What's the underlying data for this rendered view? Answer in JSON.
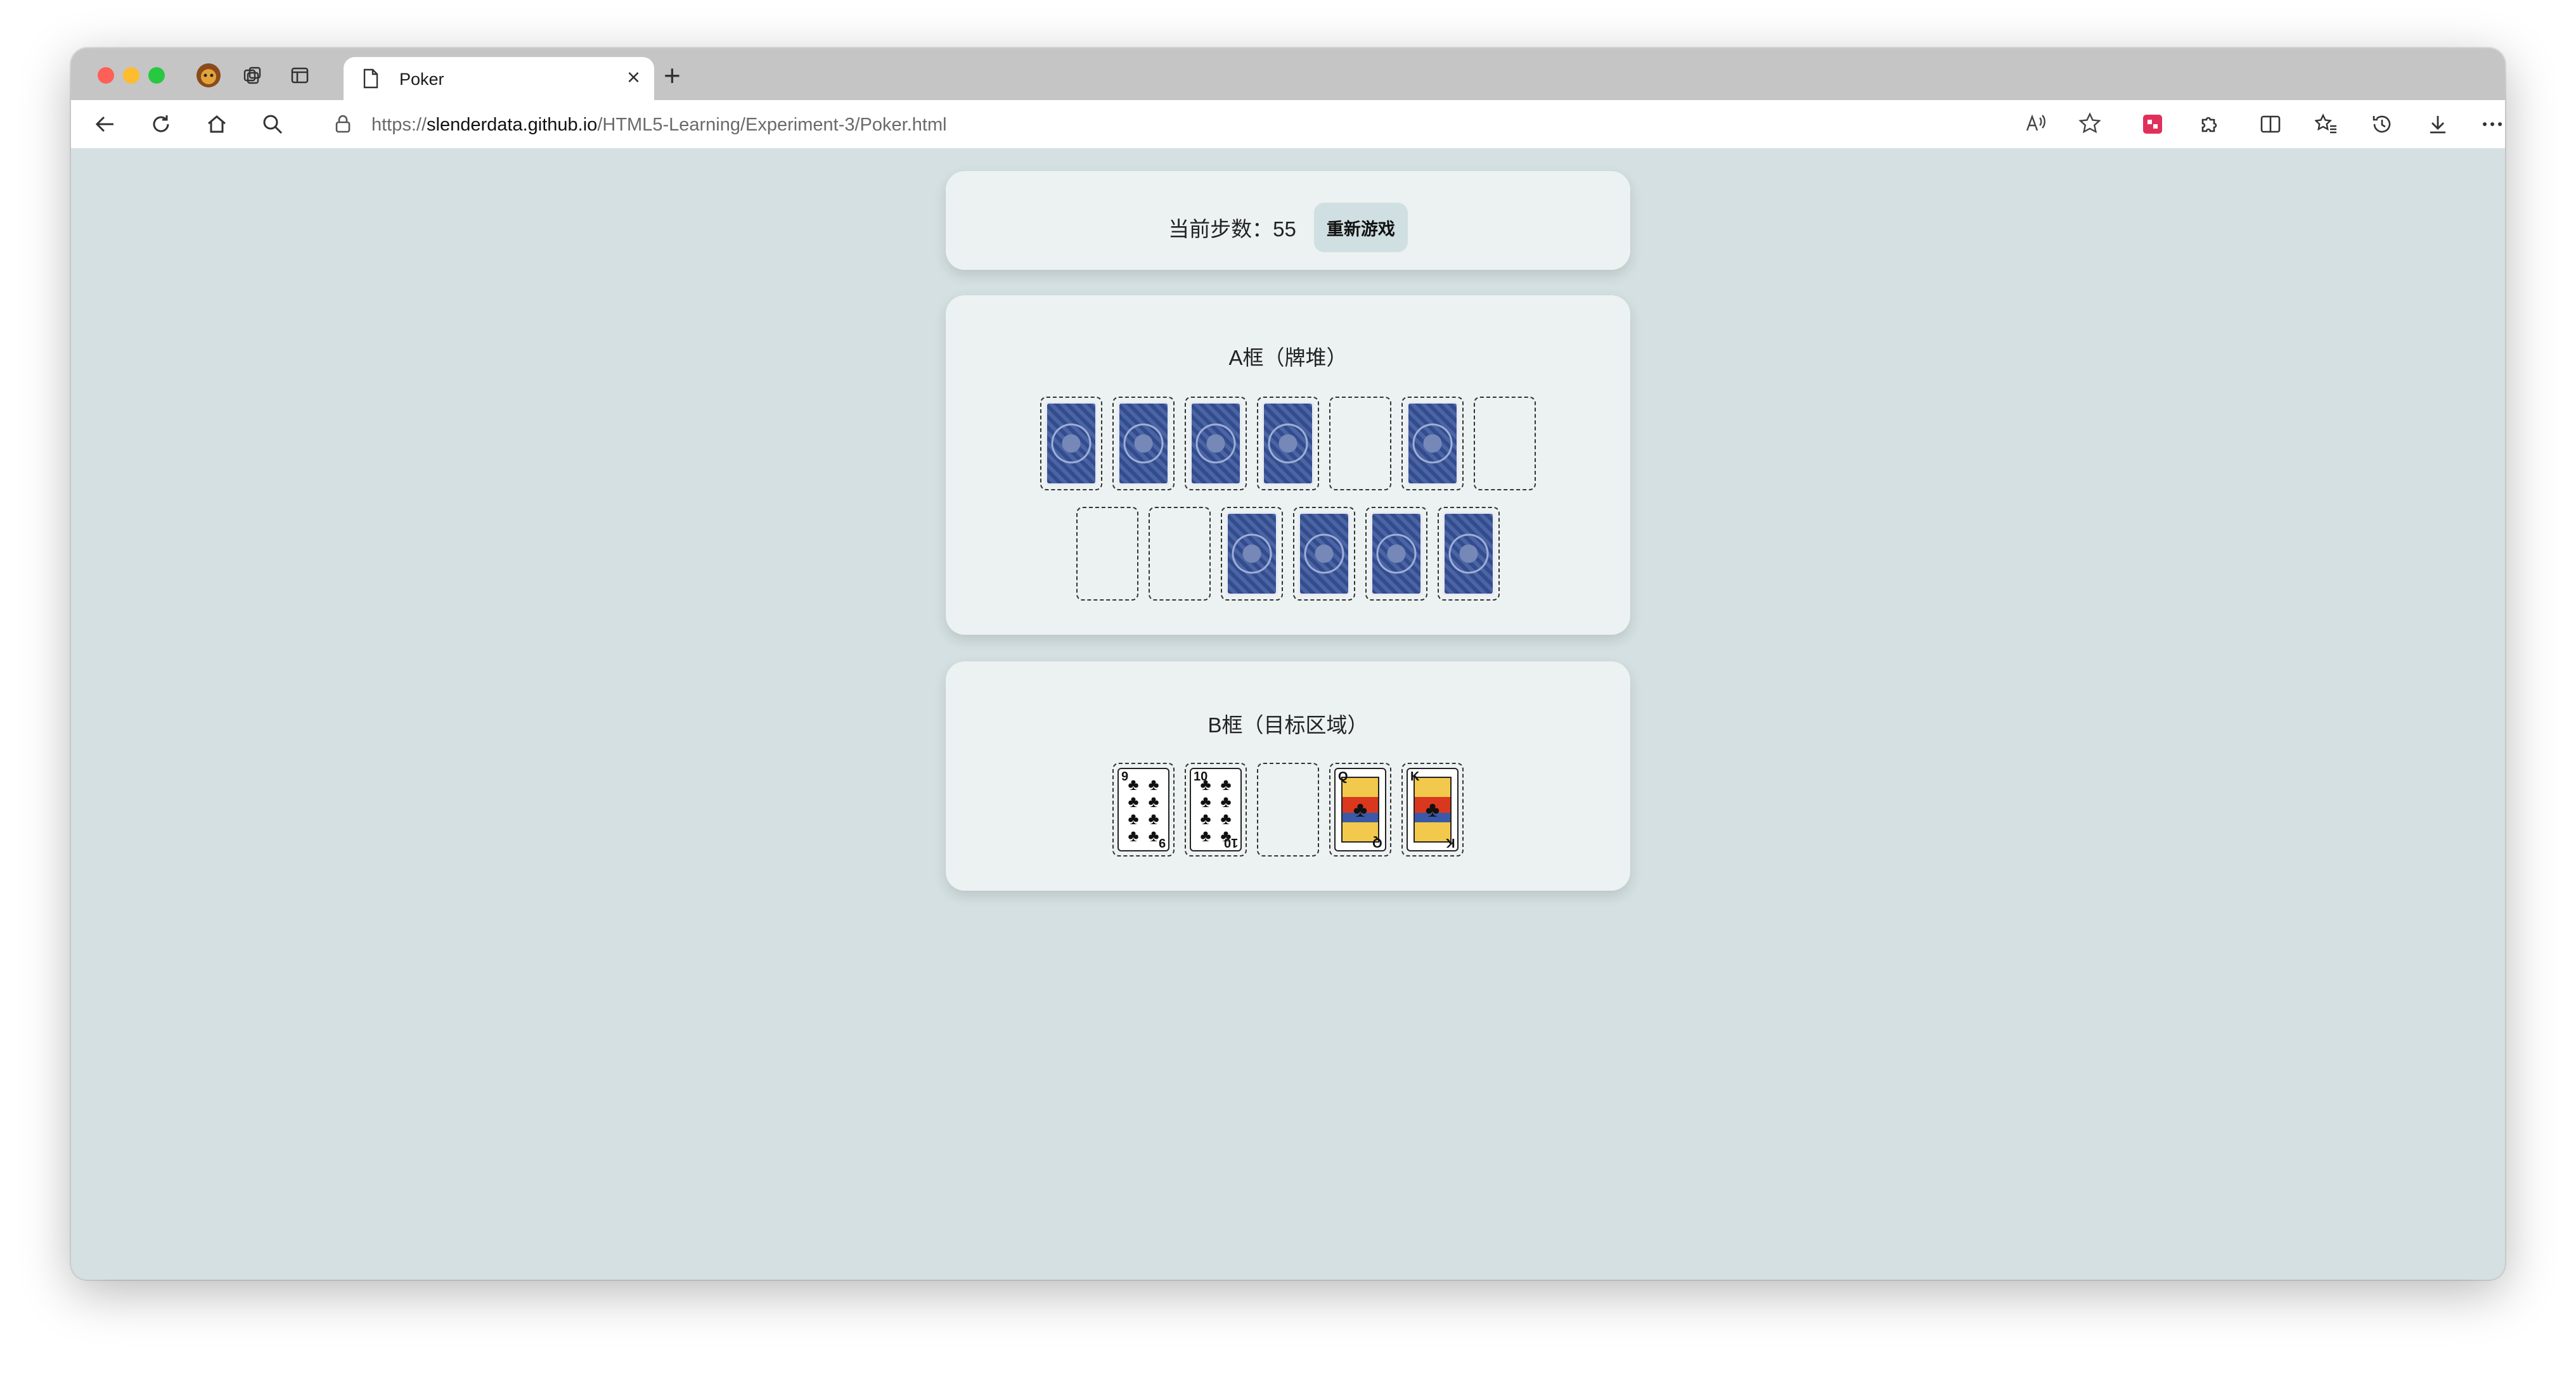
{
  "browser": {
    "tab_title": "Poker",
    "url_prefix": "https://",
    "url_host": "slenderdata.github.io",
    "url_path": "/HTML5-Learning/Experiment-3/Poker.html"
  },
  "game": {
    "steps_text": "当前步数：55",
    "restart_label": "重新游戏",
    "pile_title": "A框（牌堆）",
    "target_title": "B框（目标区域）",
    "pile_row1": [
      "back",
      "back",
      "back",
      "back",
      "empty",
      "back",
      "empty"
    ],
    "pile_row2": [
      "empty",
      "empty",
      "back",
      "back",
      "back",
      "back"
    ],
    "target_cards": [
      {
        "rank": "9",
        "suit": "♣"
      },
      {
        "rank": "10",
        "suit": "♣"
      },
      {
        "rank": "",
        "suit": ""
      },
      {
        "rank": "Q",
        "suit": "♣"
      },
      {
        "rank": "K",
        "suit": "♣"
      }
    ]
  }
}
